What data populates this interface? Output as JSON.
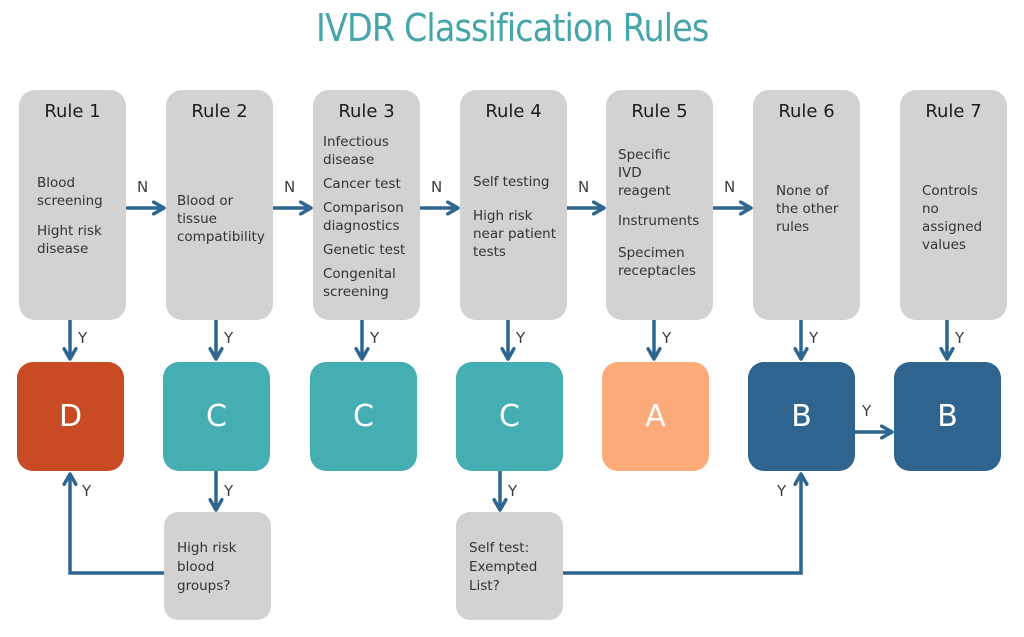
{
  "title": "IVDR Classification Rules",
  "colors": {
    "title": "#45a5aa",
    "rule_box": "#d2d2d2",
    "arrow": "#2e6690",
    "class_D": "#c84b26",
    "class_C": "#45aeb3",
    "class_A": "#fbaa78",
    "class_B": "#2e648e"
  },
  "rules": [
    {
      "label": "Rule 1",
      "items": [
        "Blood screening",
        "Hight risk disease"
      ],
      "class": "D"
    },
    {
      "label": "Rule 2",
      "items": [
        "Blood or tissue compatibility"
      ],
      "class": "C"
    },
    {
      "label": "Rule 3",
      "items": [
        "Infectious disease",
        "Cancer test",
        "Comparison diagnostics",
        "Genetic test",
        "Congenital screening"
      ],
      "class": "C"
    },
    {
      "label": "Rule 4",
      "items": [
        "Self testing",
        "High risk near patient tests"
      ],
      "class": "C"
    },
    {
      "label": "Rule 5",
      "items": [
        "Specific IVD reagent",
        "Instruments",
        "Specimen receptacles"
      ],
      "class": "A"
    },
    {
      "label": "Rule 6",
      "items": [
        "None of the other rules"
      ],
      "class": "B"
    },
    {
      "label": "Rule 7",
      "items": [
        "Controls no assigned values"
      ],
      "class": "B"
    }
  ],
  "questions": [
    {
      "text": "High risk blood groups?",
      "from_rule": "Rule 2",
      "yes_to_class": "D"
    },
    {
      "text": "Self test: Exempted List?",
      "from_rule": "Rule 4",
      "yes_to_class": "B"
    }
  ],
  "edge_labels": {
    "no": "N",
    "yes": "Y"
  }
}
